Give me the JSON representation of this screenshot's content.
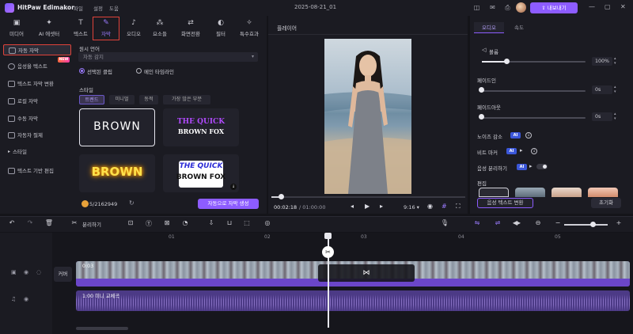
{
  "app": {
    "name": "HitPaw Edimakor",
    "menus": [
      "파일",
      "설정",
      "도움"
    ],
    "project_title": "2025-08-21_01",
    "export_label": "내보내기"
  },
  "toptabs": [
    {
      "label": "미디어",
      "icon": "media-icon"
    },
    {
      "label": "AI 에셋터",
      "icon": "ai-icon"
    },
    {
      "label": "텍스트",
      "icon": "text-icon"
    },
    {
      "label": "자막",
      "icon": "captions-icon"
    },
    {
      "label": "오디오",
      "icon": "audio-icon"
    },
    {
      "label": "요소들",
      "icon": "elements-icon"
    },
    {
      "label": "화면전환",
      "icon": "transition-icon"
    },
    {
      "label": "필터",
      "icon": "filter-icon"
    },
    {
      "label": "특수효과",
      "icon": "effects-icon"
    }
  ],
  "subnav": {
    "items": [
      "자동 자막",
      "음성을 텍스트",
      "텍스트 자막 변환",
      "로컬 자막",
      "수동 자막",
      "자동자 절제",
      "스타일",
      "텍스트 기반 편집"
    ],
    "new_badge": "NEW"
  },
  "center": {
    "lang_label": "원시 언어",
    "lang_placeholder": "자동 감지",
    "radio_selected": "선택된 클립",
    "radio_other": "메인 타임라인",
    "style_label": "스타일",
    "style_tabs": [
      "트렌드",
      "미니멀",
      "동적",
      "가장 많은 부분"
    ],
    "cards": {
      "c1": "BROWN",
      "c2_top": "THE QUICK",
      "c2_bottom": "BROWN FOX",
      "c3": "BROWN",
      "c4_top": "THE QUICK",
      "c4_bottom": "BROWN FOX"
    },
    "credits": "5/2162949",
    "generate_label": "자동으로 자막 생성"
  },
  "player": {
    "title": "플레이어",
    "time_current": "00:02:18",
    "time_total": "/ 01:00:00",
    "ratio": "9:16"
  },
  "right": {
    "tabs": [
      "오디오",
      "속도"
    ],
    "volume_label": "볼륨",
    "volume_value": "100%",
    "fadein_label": "페이드인",
    "fadein_value": "0s",
    "fadeout_label": "페이드아웃",
    "fadeout_value": "0s",
    "noise_label": "노이즈 감소",
    "beat_label": "비트 마커",
    "voice_sep_label": "음성 분리하기",
    "edit_label": "편집",
    "ai_badge": "AI",
    "split_btn": "음성 텍스트 변환",
    "reset_btn": "초기화"
  },
  "timeline": {
    "split_label": "분리하기",
    "ruler": [
      "01",
      "02",
      "03",
      "04",
      "05"
    ],
    "cover_label": "커버",
    "video_label": "0:03",
    "audio_label": "1:00 미니 교체곡"
  }
}
